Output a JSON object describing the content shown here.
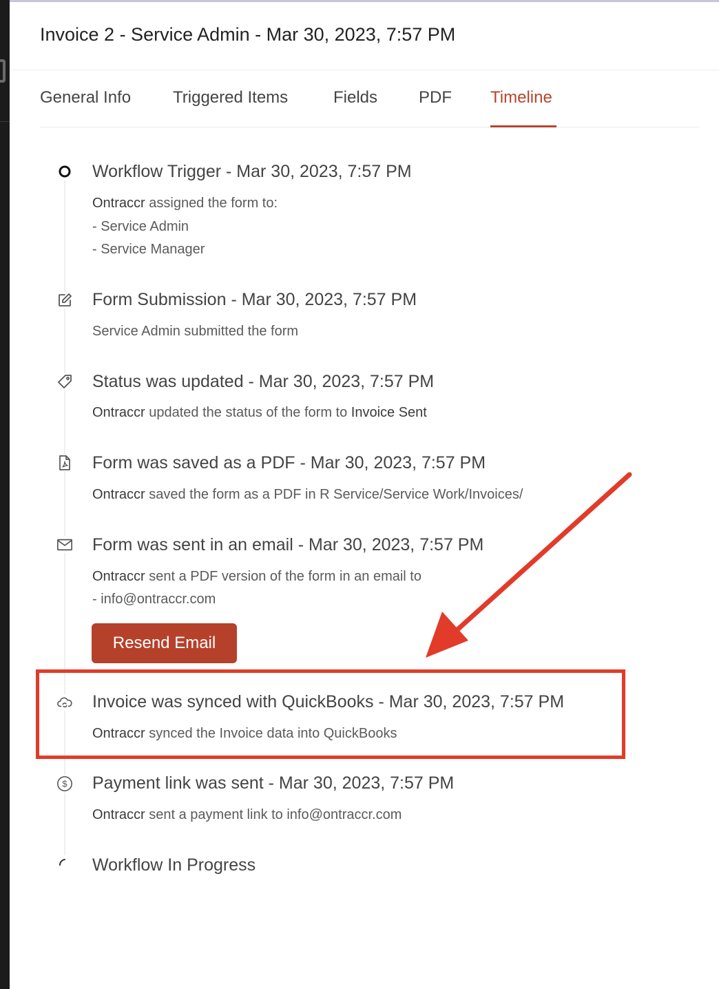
{
  "header": {
    "title": "Invoice 2 - Service Admin - Mar 30, 2023, 7:57 PM"
  },
  "tabs": [
    {
      "label": "General Info",
      "active": false
    },
    {
      "label": "Triggered Items",
      "active": false
    },
    {
      "label": "Fields",
      "active": false
    },
    {
      "label": "PDF",
      "active": false
    },
    {
      "label": "Timeline",
      "active": true
    }
  ],
  "timeline": {
    "events": [
      {
        "icon": "circle-icon",
        "title": "Workflow Trigger - Mar 30, 2023, 7:57 PM",
        "actor": "Ontraccr",
        "text": "assigned the form to:",
        "items": [
          "- Service Admin",
          "- Service Manager"
        ]
      },
      {
        "icon": "edit-icon",
        "title": "Form Submission - Mar 30, 2023, 7:57 PM",
        "text": "Service Admin submitted the form"
      },
      {
        "icon": "tag-icon",
        "title": "Status was updated - Mar 30, 2023, 7:57 PM",
        "actor": "Ontraccr",
        "text": "updated the status of the form to",
        "status": "Invoice Sent"
      },
      {
        "icon": "pdf-file-icon",
        "title": "Form was saved as a PDF - Mar 30, 2023, 7:57 PM",
        "actor": "Ontraccr",
        "text": "saved the form as a PDF in R Service/Service Work/Invoices/"
      },
      {
        "icon": "mail-icon",
        "title": "Form was sent in an email - Mar 30, 2023, 7:57 PM",
        "actor": "Ontraccr",
        "text": "sent a PDF version of the form in an email to",
        "items": [
          "- info@ontraccr.com"
        ],
        "button": "Resend Email"
      },
      {
        "icon": "cloud-sync-icon",
        "title": "Invoice was synced with QuickBooks - Mar 30, 2023, 7:57 PM",
        "actor": "Ontraccr",
        "text": "synced the Invoice data into QuickBooks"
      },
      {
        "icon": "dollar-circle-icon",
        "title": "Payment link was sent - Mar 30, 2023, 7:57 PM",
        "actor": "Ontraccr",
        "text": "sent a payment link to info@ontraccr.com"
      },
      {
        "icon": "loading-spinner-icon",
        "title": "Workflow In Progress"
      }
    ]
  },
  "annotation_color": "#e23b2a",
  "accent_color": "#b5442b"
}
